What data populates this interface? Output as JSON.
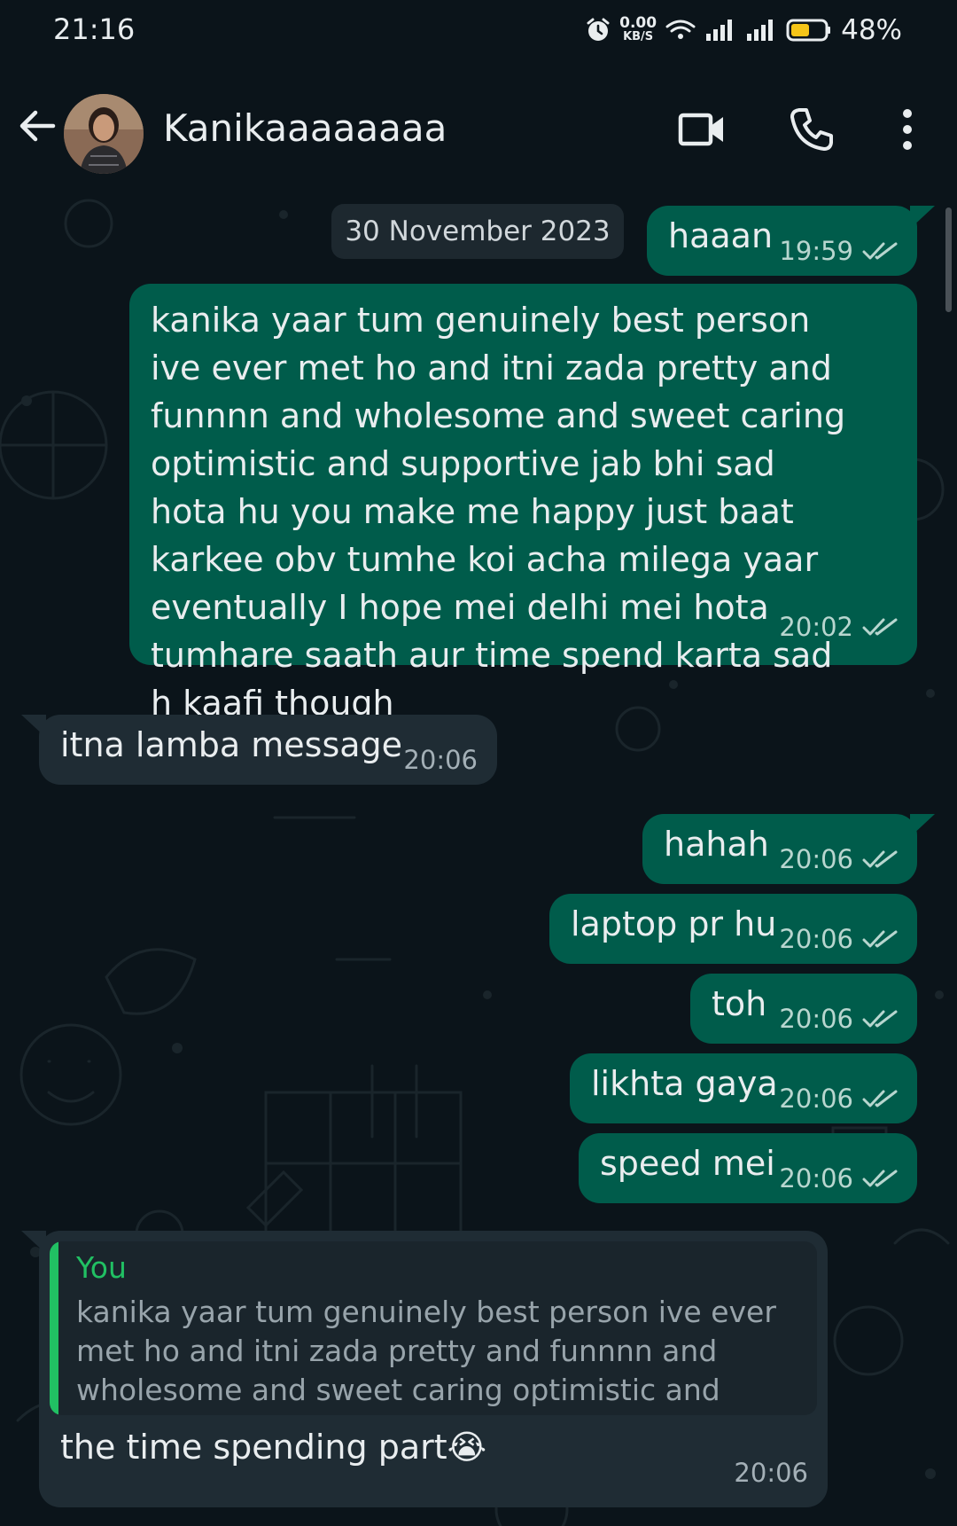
{
  "status_bar": {
    "time": "21:16",
    "net_speed": "0.00",
    "net_unit": "KB/S",
    "battery": "48%",
    "icons": [
      "alarm-icon",
      "wifi-icon",
      "signal-icon",
      "signal-icon",
      "battery-icon"
    ]
  },
  "header": {
    "contact_name": "Kanikaaaaaaaa",
    "icons": [
      "back-arrow-icon",
      "video-call-icon",
      "phone-icon",
      "more-options-icon"
    ]
  },
  "chat": {
    "date": "30 November 2023",
    "messages": [
      {
        "dir": "out",
        "text": "haaan",
        "time": "19:59",
        "status": "read"
      },
      {
        "dir": "out",
        "text": "kanika yaar tum genuinely best person ive ever met ho and itni zada pretty and funnnn and wholesome and sweet caring optimistic and supportive jab bhi sad hota hu you make me happy just baat karkee obv tumhe koi acha milega yaar eventually I hope mei delhi mei hota tumhare saath aur time spend karta sad h kaafi though",
        "time": "20:02",
        "status": "read"
      },
      {
        "dir": "in",
        "text": "itna lamba message",
        "time": "20:06"
      },
      {
        "dir": "out",
        "text": "hahah",
        "time": "20:06",
        "status": "read"
      },
      {
        "dir": "out",
        "text": "laptop pr hu",
        "time": "20:06",
        "status": "read"
      },
      {
        "dir": "out",
        "text": "toh",
        "time": "20:06",
        "status": "read"
      },
      {
        "dir": "out",
        "text": "likhta gaya",
        "time": "20:06",
        "status": "read"
      },
      {
        "dir": "out",
        "text": "speed mei",
        "time": "20:06",
        "status": "read"
      },
      {
        "dir": "in",
        "quote_author": "You",
        "quote_text": "kanika yaar tum genuinely best person ive ever met ho and itni zada pretty and funnnn and wholesome and sweet caring optimistic and sup…",
        "text": "the time spending part",
        "emoji": "😭",
        "time": "20:06"
      }
    ]
  },
  "colors": {
    "background": "#0b141a",
    "outgoing_bubble": "#005c4b",
    "incoming_bubble": "#1f2c34",
    "quote_accent": "#21c063",
    "read_tick": "#b8d6cf"
  }
}
